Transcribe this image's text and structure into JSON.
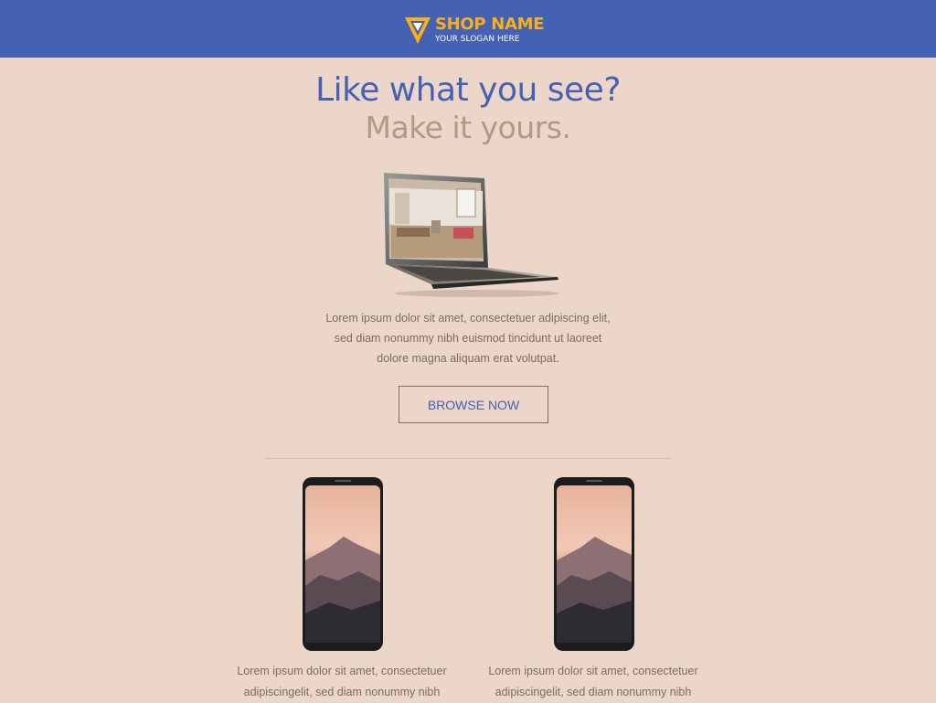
{
  "header": {
    "shop_name": "SHOP NAME",
    "slogan": "YOUR SLOGAN HERE",
    "logo_icon": "triangle-logo-icon",
    "colors": {
      "bar": "#4561b3",
      "brand": "#f7b01a"
    }
  },
  "hero": {
    "title": "Like what you see?",
    "subtitle": "Make it yours.",
    "image": "laptop-image",
    "body": "Lorem ipsum dolor sit amet, consectetuer adipiscing elit, sed diam nonummy nibh euismod tincidunt ut laoreet dolore magna aliquam erat volutpat.",
    "button_label": "BROWSE NOW"
  },
  "products": [
    {
      "image": "smartphone-image",
      "text": "Lorem ipsum dolor sit amet, consectetuer adipiscingelit, sed diam nonummy nibh"
    },
    {
      "image": "smartphone-image",
      "text": "Lorem ipsum dolor sit amet, consectetuer adipiscingelit, sed diam nonummy nibh"
    }
  ],
  "colors": {
    "background": "#ecd6c9",
    "primary": "#4561b3",
    "muted": "#b19a83"
  }
}
